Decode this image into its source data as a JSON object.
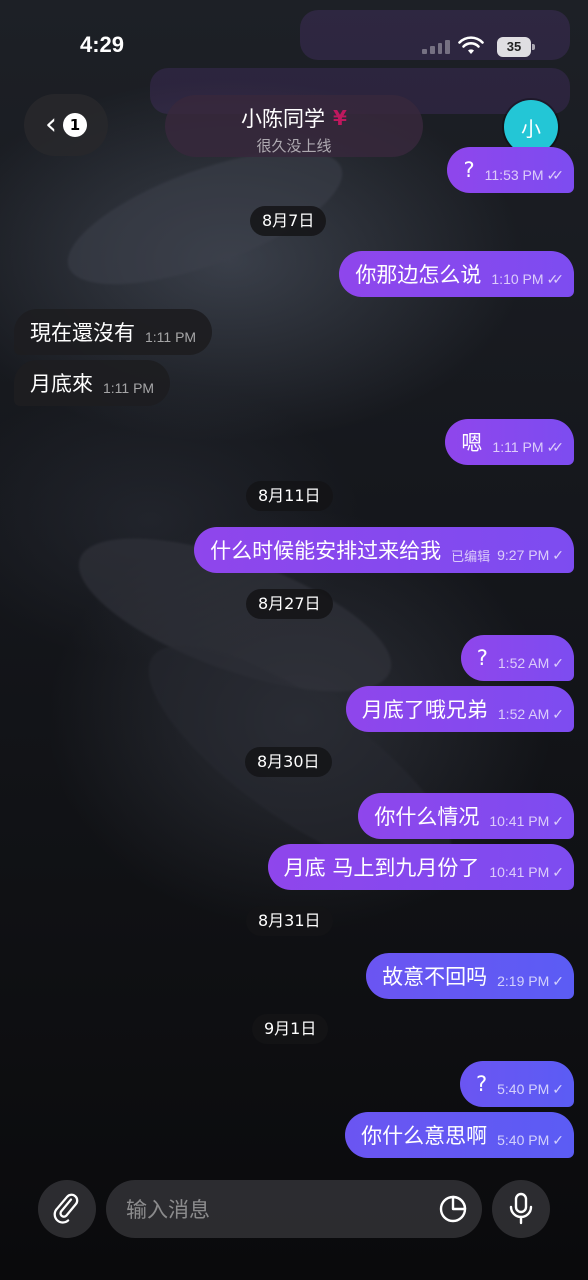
{
  "status_bar": {
    "time": "4:29",
    "battery": "35"
  },
  "header": {
    "back_count": "1",
    "contact_name": "小陈同学",
    "contact_emoji": "¥",
    "contact_status": "很久没上线",
    "avatar_initial": "小"
  },
  "messages": [
    {
      "type": "out",
      "text": "?",
      "time": "11:53 PM",
      "check": "✓✓"
    },
    {
      "type": "date",
      "text": "8月7日"
    },
    {
      "type": "out",
      "text": "你那边怎么说",
      "time": "1:10 PM",
      "check": "✓✓"
    },
    {
      "type": "in",
      "text": "現在還沒有",
      "time": "1:11 PM"
    },
    {
      "type": "in",
      "text": "月底來",
      "time": "1:11 PM"
    },
    {
      "type": "out",
      "text": "嗯",
      "time": "1:11 PM",
      "check": "✓✓"
    },
    {
      "type": "date",
      "text": "8月11日"
    },
    {
      "type": "out",
      "text": "什么时候能安排过来给我",
      "edited": "已编辑",
      "time": "9:27 PM",
      "check": "✓"
    },
    {
      "type": "date",
      "text": "8月27日"
    },
    {
      "type": "out",
      "text": "?",
      "time": "1:52 AM",
      "check": "✓"
    },
    {
      "type": "out",
      "text": "月底了哦兄弟",
      "time": "1:52 AM",
      "check": "✓"
    },
    {
      "type": "date",
      "text": "8月30日"
    },
    {
      "type": "out",
      "text": "你什么情况",
      "time": "10:41 PM",
      "check": "✓"
    },
    {
      "type": "out",
      "text": "月底 马上到九月份了",
      "time": "10:41 PM",
      "check": "✓"
    },
    {
      "type": "date",
      "text": "8月31日"
    },
    {
      "type": "out",
      "text": "故意不回吗",
      "time": "2:19 PM",
      "check": "✓"
    },
    {
      "type": "date",
      "text": "9月1日"
    },
    {
      "type": "out",
      "text": "?",
      "time": "5:40 PM",
      "check": "✓"
    },
    {
      "type": "out",
      "text": "你什么意思啊",
      "time": "5:40 PM",
      "check": "✓"
    }
  ],
  "composer": {
    "placeholder": "输入消息"
  },
  "icons": {
    "back": "chevron-left-icon",
    "attach": "paperclip-icon",
    "sticker": "sticker-icon",
    "mic": "microphone-icon",
    "wifi": "wifi-icon",
    "signal": "signal-icon",
    "battery": "battery-icon"
  },
  "colors": {
    "outgoing_bubble": "#8f46ec",
    "outgoing_bubble_late": "#5b5cf4",
    "incoming_bubble": "#1e1e21",
    "avatar": "#23c6d6"
  }
}
